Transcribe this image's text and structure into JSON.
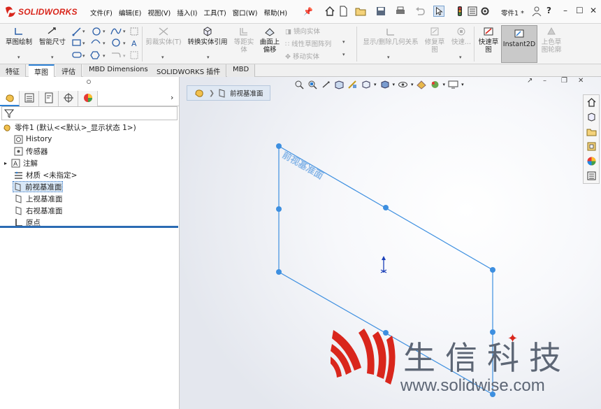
{
  "app": {
    "logo_text": "SOLIDWORKS",
    "document_name": "零件1 *",
    "menu": [
      "文件(F)",
      "编辑(E)",
      "视图(V)",
      "插入(I)",
      "工具(T)",
      "窗口(W)",
      "帮助(H)"
    ],
    "help_label": "?"
  },
  "command_manager": {
    "sketch": "草图绘制",
    "smart_dim": "智能尺寸",
    "trim": "剪裁实体(T)",
    "convert": "转换实体引用",
    "offset_l1": "等距实",
    "offset_l2": "体",
    "surface_offset_l1": "曲面上",
    "surface_offset_l2": "偏移",
    "mirror": "镜向实体",
    "linear_pattern": "线性草图阵列",
    "move": "移动实体",
    "relations": "显示/删除几何关系",
    "repair_l1": "修复草",
    "repair_l2": "图",
    "quick_snaps": "快速...",
    "rapid_l1": "快速草",
    "rapid_l2": "图",
    "instant2d": "Instant2D",
    "shaded_l1": "上色草",
    "shaded_l2": "图轮廓"
  },
  "tabs": [
    "特征",
    "草图",
    "评估",
    "MBD Dimensions",
    "SOLIDWORKS 插件",
    "MBD"
  ],
  "active_tab": 1,
  "feature_tree": {
    "root": "零件1  (默认<<默认>_显示状态 1>)",
    "items": [
      "History",
      "传感器",
      "注解",
      "材质 <未指定>",
      "前视基准面",
      "上视基准面",
      "右视基准面",
      "原点"
    ],
    "selected_index": 4
  },
  "viewport": {
    "breadcrumb": "前视基准面",
    "plane_label": "前视基准面",
    "watermark_cn": "生信科技",
    "watermark_url": "www.solidwise.com"
  },
  "colors": {
    "brand_red": "#d9261c",
    "selection_blue": "#3d8fe0",
    "accent_blue": "#2a7fd4"
  }
}
